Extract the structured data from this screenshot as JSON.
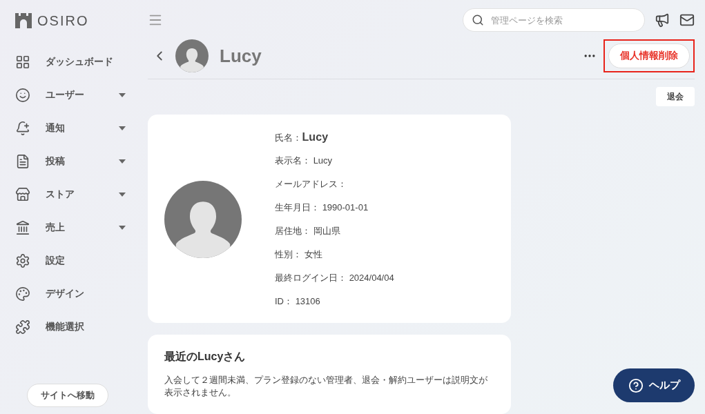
{
  "logo": {
    "text": "OSIRO"
  },
  "sidebar": {
    "items": [
      {
        "kind": "dashboard",
        "label": "ダッシュボード",
        "expandable": false
      },
      {
        "kind": "user",
        "label": "ユーザー",
        "expandable": true
      },
      {
        "kind": "bell",
        "label": "通知",
        "expandable": true
      },
      {
        "kind": "file",
        "label": "投稿",
        "expandable": true
      },
      {
        "kind": "store",
        "label": "ストア",
        "expandable": true
      },
      {
        "kind": "bank",
        "label": "売上",
        "expandable": true
      },
      {
        "kind": "gear",
        "label": "設定",
        "expandable": false
      },
      {
        "kind": "palette",
        "label": "デザイン",
        "expandable": false
      },
      {
        "kind": "puzzle",
        "label": "機能選択",
        "expandable": false
      }
    ],
    "site_button": "サイトへ移動"
  },
  "search": {
    "placeholder": "管理ページを検索"
  },
  "profile": {
    "name": "Lucy",
    "delete_button": {
      "label": "個人情報削除",
      "highlighted": true
    },
    "withdraw_button": "退会"
  },
  "details": [
    {
      "label": "氏名：",
      "value": "Lucy",
      "emphasized": true
    },
    {
      "label": "表示名：",
      "value": "Lucy",
      "emphasized": false
    },
    {
      "label": "メールアドレス：",
      "emphasized": false
    },
    {
      "label": "生年月日：",
      "value": "1990-01-01",
      "emphasized": false
    },
    {
      "label": "居住地：",
      "value": "岡山県",
      "emphasized": false
    },
    {
      "label": "性別：",
      "value": "女性",
      "emphasized": false
    },
    {
      "label": "最終ログイン日：",
      "value": "2024/04/04",
      "emphasized": false
    },
    {
      "label": "ID：",
      "value": "13106",
      "emphasized": false
    }
  ],
  "recent": {
    "title": "最近のLucyさん",
    "text": "入会して２週間未満、プラン登録のない管理者、退会・解約ユーザーは説明文が表示されません。"
  },
  "help_button": "ヘルプ"
}
